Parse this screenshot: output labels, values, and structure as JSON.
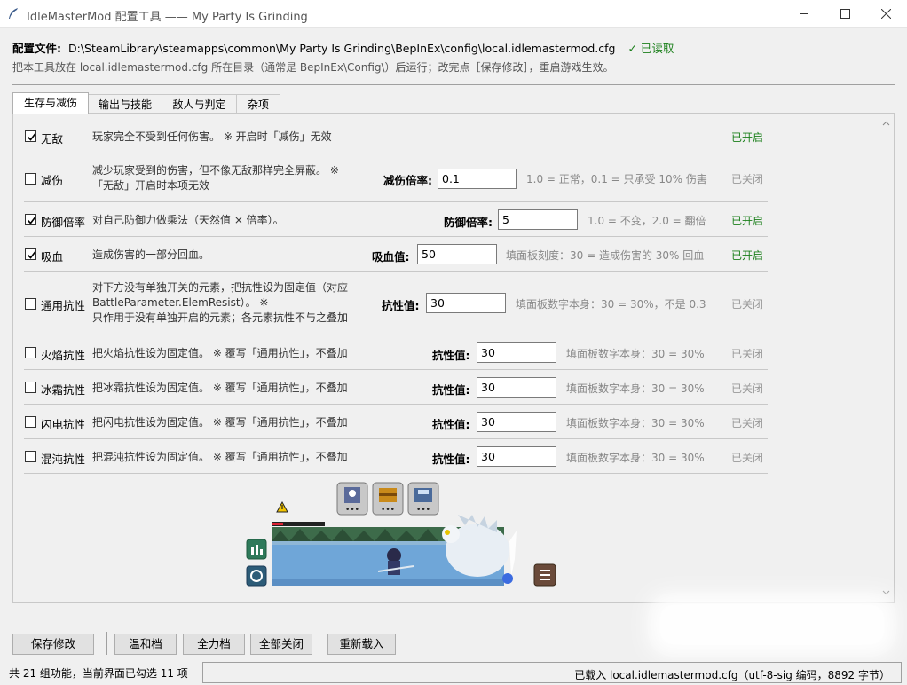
{
  "window": {
    "title": "IdleMasterMod 配置工具 —— My Party Is Grinding",
    "minimize_icon": "minimize-icon",
    "maximize_icon": "maximize-icon",
    "close_icon": "close-icon"
  },
  "config": {
    "label": "配置文件:",
    "path": "D:\\SteamLibrary\\steamapps\\common\\My Party Is Grinding\\BepInEx\\config\\local.idlemastermod.cfg",
    "state": "✓ 已读取",
    "hint": "把本工具放在 local.idlemastermod.cfg 所在目录（通常是 BepInEx\\Config\\）后运行；改完点［保存修改］，重启游戏生效。"
  },
  "tabs": [
    {
      "label": "生存与减伤",
      "active": true
    },
    {
      "label": "输出与技能",
      "active": false
    },
    {
      "label": "敌人与判定",
      "active": false
    },
    {
      "label": "杂项",
      "active": false
    }
  ],
  "rows": [
    {
      "name": "无敌",
      "checked": true,
      "desc": [
        "玩家完全不受到任何伤害。 ※ 开启时「减伤」无效"
      ],
      "param_label": "",
      "param_value": "",
      "param_hint": "",
      "status": "已开启"
    },
    {
      "name": "减伤",
      "checked": false,
      "desc": [
        "减少玩家受到的伤害，但不像无敌那样完全屏蔽。 ※",
        "「无敌」开启时本项无效"
      ],
      "param_label": "减伤倍率:",
      "param_value": "0.1",
      "param_hint": "1.0 = 正常，0.1 = 只承受 10% 伤害",
      "status": "已关闭"
    },
    {
      "name": "防御倍率",
      "checked": true,
      "desc": [
        "对自己防御力做乘法（天然值 × 倍率）。"
      ],
      "param_label": "防御倍率:",
      "param_value": "5",
      "param_hint": "1.0 = 不变，2.0 = 翻倍",
      "status": "已开启"
    },
    {
      "name": "吸血",
      "checked": true,
      "desc": [
        "造成伤害的一部分回血。"
      ],
      "param_label": "吸血值:",
      "param_value": "50",
      "param_hint": "填面板刻度：30 = 造成伤害的 30% 回血",
      "status": "已开启"
    },
    {
      "name": "通用抗性",
      "checked": false,
      "desc": [
        "对下方没有单独开关的元素，把抗性设为固定值（对应",
        "BattleParameter.ElemResist）。 ※",
        "只作用于没有单独开启的元素；各元素抗性不与之叠加"
      ],
      "param_label": "抗性值:",
      "param_value": "30",
      "param_hint": "填面板数字本身：30 = 30%，不是 0.3",
      "status": "已关闭"
    },
    {
      "name": "火焰抗性",
      "checked": false,
      "desc": [
        "把火焰抗性设为固定值。 ※ 覆写「通用抗性」，不叠加"
      ],
      "param_label": "抗性值:",
      "param_value": "30",
      "param_hint": "填面板数字本身：30 = 30%",
      "status": "已关闭"
    },
    {
      "name": "冰霜抗性",
      "checked": false,
      "desc": [
        "把冰霜抗性设为固定值。 ※ 覆写「通用抗性」，不叠加"
      ],
      "param_label": "抗性值:",
      "param_value": "30",
      "param_hint": "填面板数字本身：30 = 30%",
      "status": "已关闭"
    },
    {
      "name": "闪电抗性",
      "checked": false,
      "desc": [
        "把闪电抗性设为固定值。 ※ 覆写「通用抗性」，不叠加"
      ],
      "param_label": "抗性值:",
      "param_value": "30",
      "param_hint": "填面板数字本身：30 = 30%",
      "status": "已关闭"
    },
    {
      "name": "混沌抗性",
      "checked": false,
      "desc": [
        "把混沌抗性设为固定值。 ※ 覆写「通用抗性」，不叠加"
      ],
      "param_label": "抗性值:",
      "param_value": "30",
      "param_hint": "填面板数字本身：30 = 30%",
      "status": "已关闭"
    }
  ],
  "game_widget": {
    "skill_icons": [
      "skill-icon-warrior",
      "skill-icon-chest",
      "skill-icon-save"
    ],
    "warning_icon": "warning-icon",
    "stats_icon": "stats-icon",
    "refresh_icon": "refresh-icon",
    "menu_icon": "menu-icon"
  },
  "buttons": {
    "save": "保存修改",
    "mild": "温和档",
    "full": "全力档",
    "all_off": "全部关闭",
    "reload": "重新载入"
  },
  "statusbar": {
    "left": "共 21 组功能，当前界面已勾选 11 项",
    "right": "已载入 local.idlemastermod.cfg（utf-8-sig 编码，8892 字节）"
  },
  "colors": {
    "enabled": "#1a7f1a",
    "disabled": "#999999",
    "tab_active_bg": "#ffffff"
  }
}
